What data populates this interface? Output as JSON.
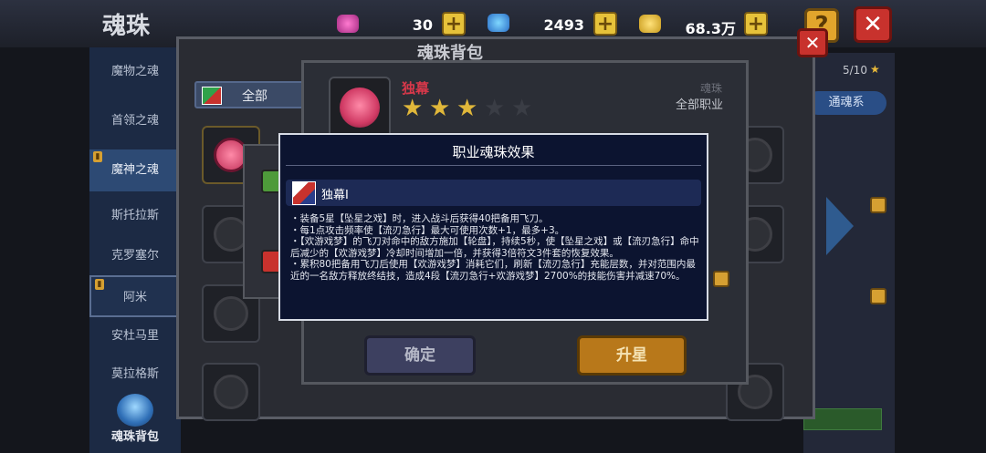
{
  "header": {
    "title": "魂珠",
    "resources": [
      {
        "icon": "pink-gem-icon",
        "value": "30"
      },
      {
        "icon": "blue-gem-icon",
        "value": "2493"
      },
      {
        "icon": "gold-coin-icon",
        "value": "68.3万"
      }
    ],
    "help_label": "?",
    "close_label": "✕"
  },
  "sidebar": {
    "items": [
      {
        "label": "魔物之魂"
      },
      {
        "label": "首领之魂"
      },
      {
        "label": "魔神之魂"
      },
      {
        "label": "斯托拉斯"
      },
      {
        "label": "克罗塞尔"
      },
      {
        "label": "阿米"
      },
      {
        "label": "安杜马里"
      },
      {
        "label": "莫拉格斯"
      }
    ],
    "bag_label": "魂珠背包"
  },
  "bag_panel": {
    "title": "魂珠背包",
    "filter": {
      "selected": "全部"
    },
    "count": "5/10",
    "tab": "通魂系",
    "close_label": "✕"
  },
  "soul_card": {
    "name": "独幕",
    "stars_total": 5,
    "stars_filled": 3,
    "type": "魂珠",
    "class": "全部职业",
    "confirm_label": "确定",
    "upgrade_label": "升星"
  },
  "effect_dialog": {
    "title": "职业魂珠效果",
    "header_name": "独幕Ⅰ",
    "body": "・装备5星【坠星之戏】时，进入战斗后获得40把备用飞刀。\n・每1点攻击频率使【流刃急行】最大可使用次数+1，最多+3。\n・【欢游戏梦】的飞刀对命中的敌方施加【轮盘】，持续5秒，使【坠星之戏】或【流刃急行】命中后减少的【欢游戏梦】冷却时间增加一倍，并获得3倍符文3件套的恢复效果。\n・累积80把备用飞刀后使用【欢游戏梦】消耗它们，刷新【流刃急行】充能层数，并对范围内最近的一名敌方释放终结技，造成4段【流刃急行+欢游戏梦】2700%的技能伤害并减速70%。"
  },
  "colors": {
    "accent_gold": "#e0b73a",
    "danger_red": "#c8322d",
    "name_red": "#d8384a",
    "dialog_bg": "#0c1430"
  }
}
